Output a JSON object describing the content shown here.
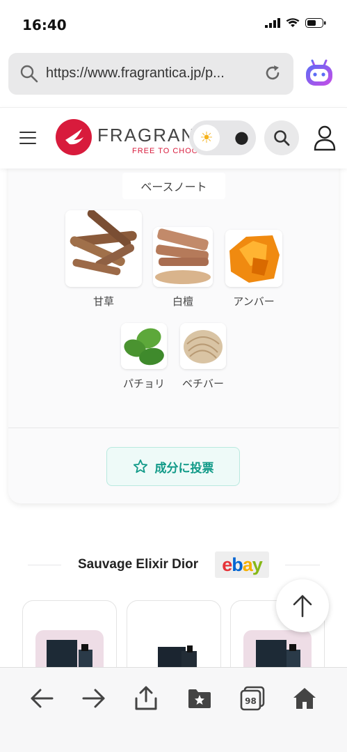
{
  "status_bar": {
    "time": "16:40"
  },
  "browser": {
    "url": "https://www.fragrantica.jp/p..."
  },
  "header": {
    "logo_text": "FRAGRANTICA",
    "logo_tagline": "FREE TO CHOOSE"
  },
  "base_notes": {
    "title": "ベースノート",
    "items": [
      {
        "label": "甘草"
      },
      {
        "label": "白檀"
      },
      {
        "label": "アンバー"
      },
      {
        "label": "パチョリ"
      },
      {
        "label": "ベチバー"
      }
    ]
  },
  "vote": {
    "label": "成分に投票"
  },
  "ebay_section": {
    "title": "Sauvage Elixir Dior",
    "badge": "ebay"
  },
  "toolbar": {
    "tabs_count": "98"
  },
  "colors": {
    "accent": "#119a88",
    "brand": "#d81b3c"
  }
}
